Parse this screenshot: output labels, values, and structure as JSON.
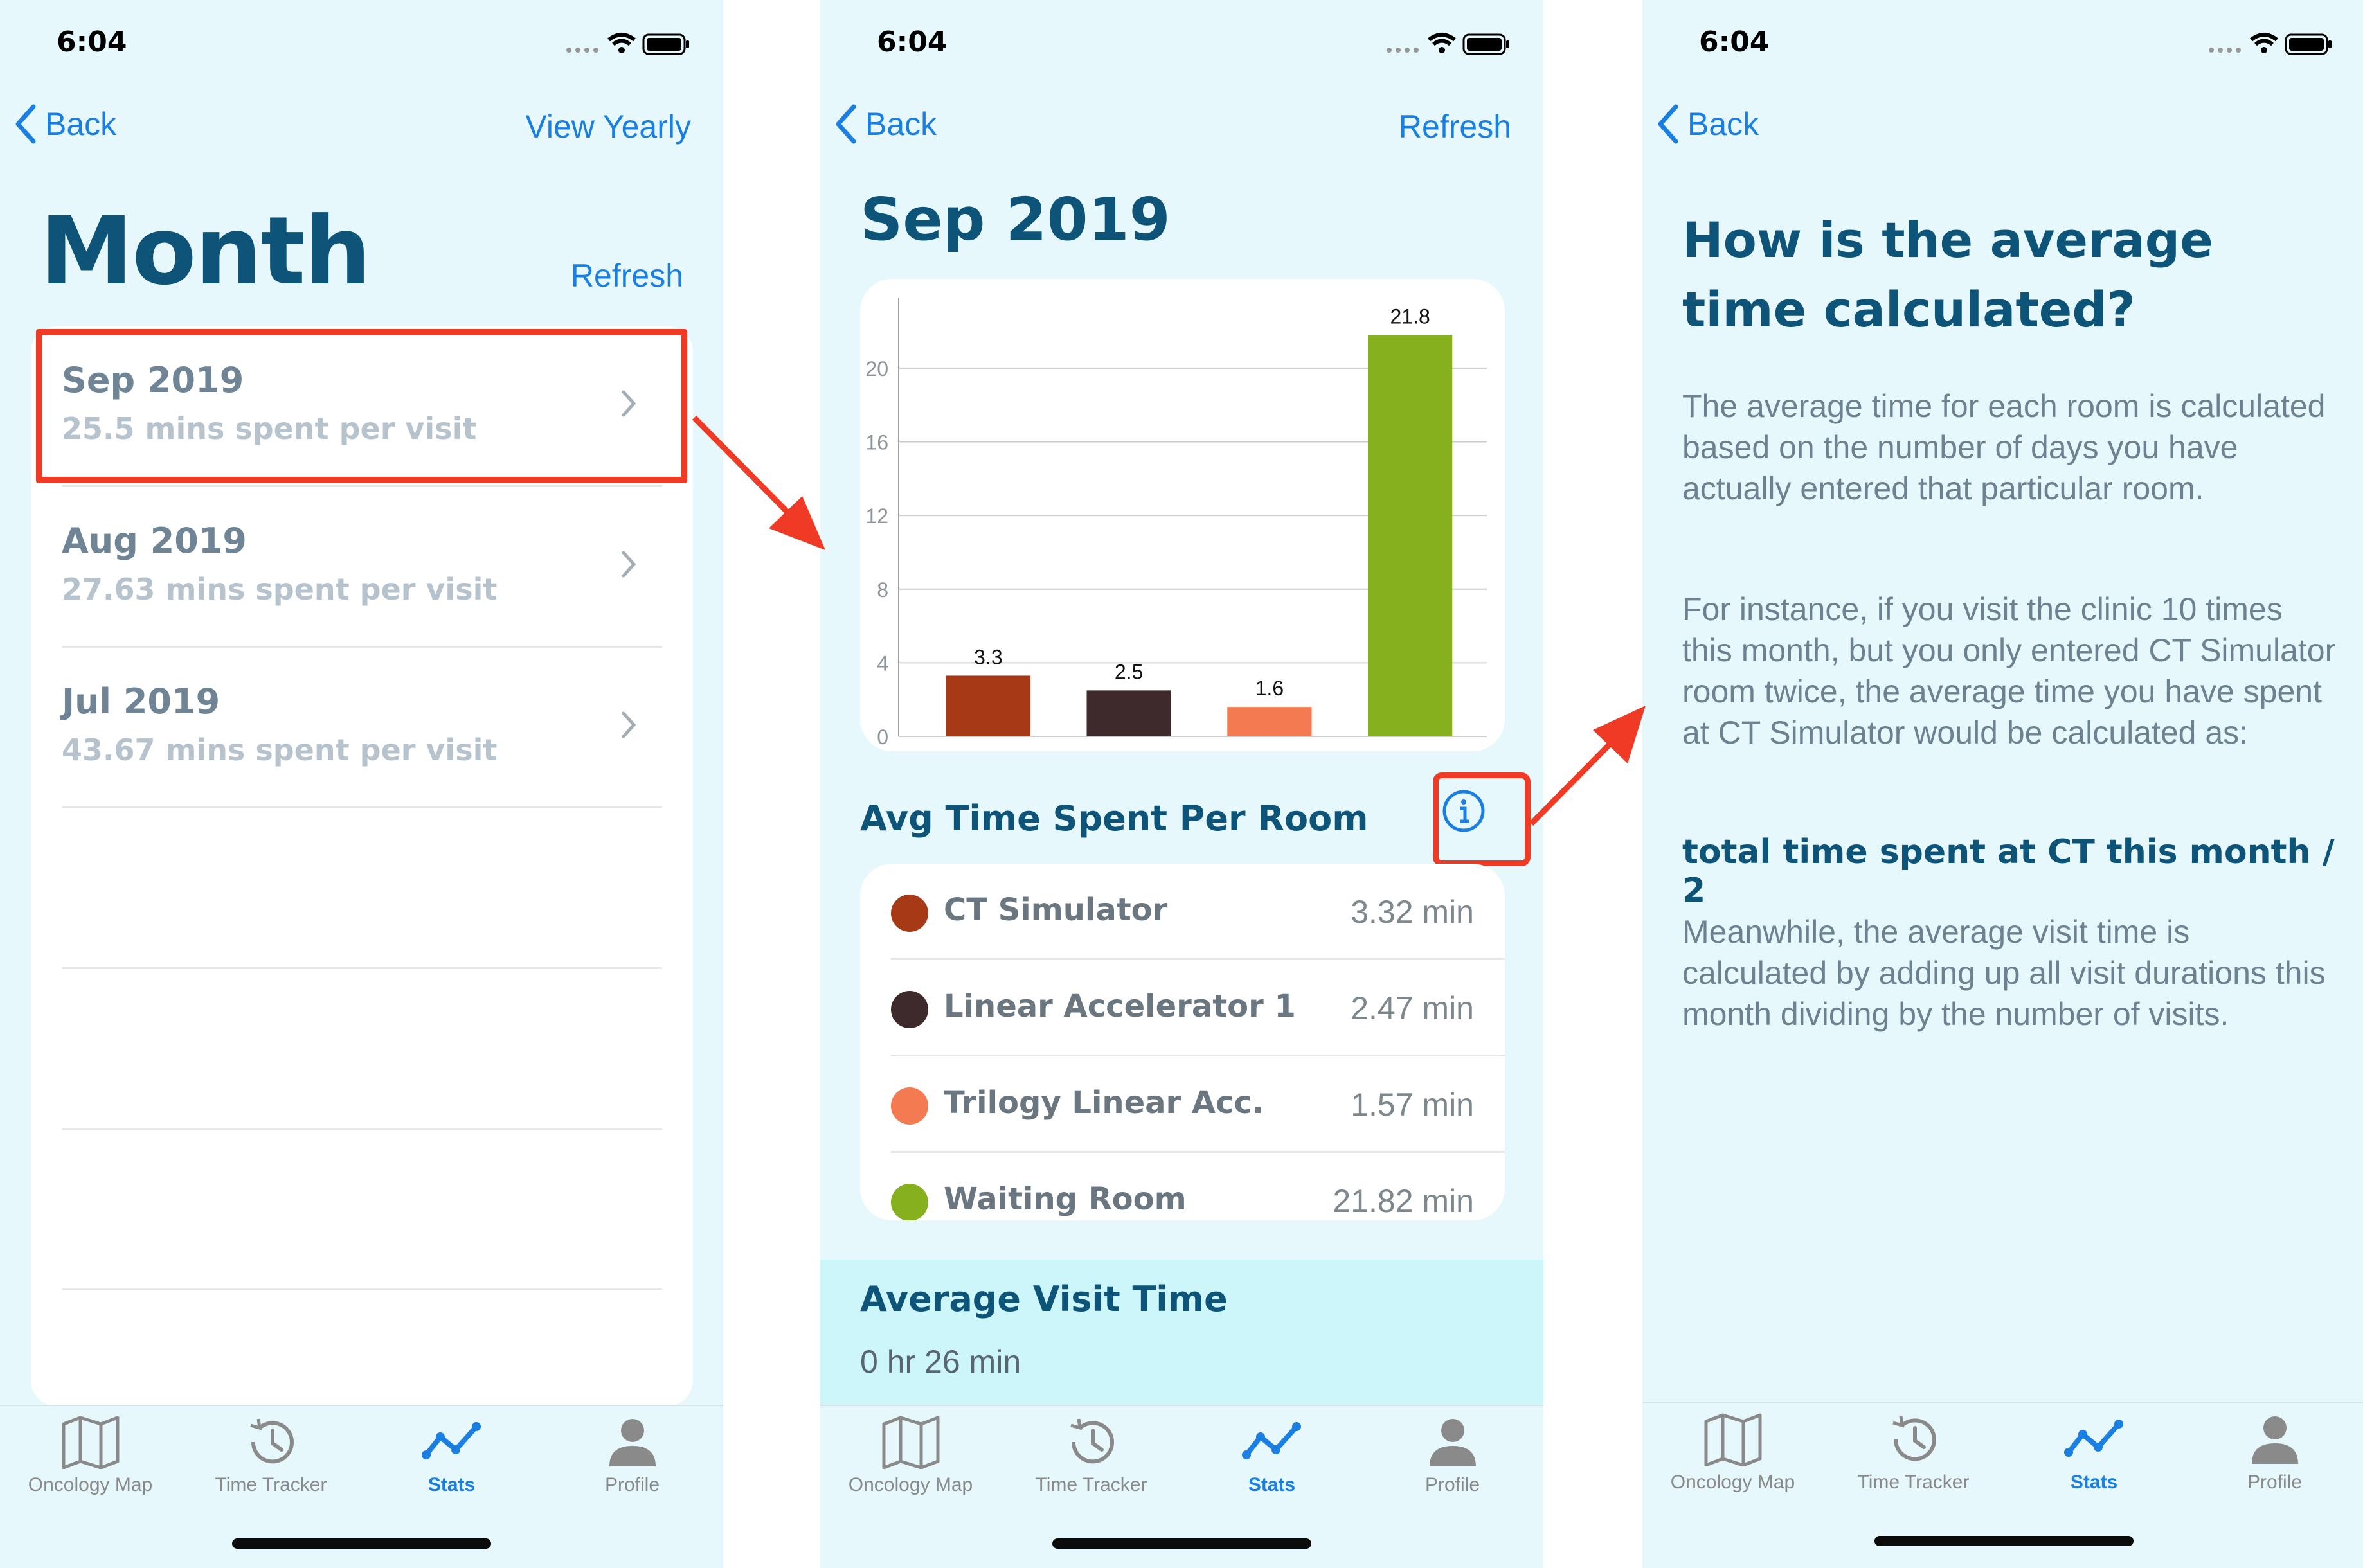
{
  "status": {
    "time": "6:04"
  },
  "colors": {
    "accent": "#1a7fe0",
    "title": "#0d5478",
    "highlight": "#ef3a25",
    "background": "#e6f8fc"
  },
  "tabs": [
    {
      "label": "Oncology Map",
      "icon": "map-icon"
    },
    {
      "label": "Time Tracker",
      "icon": "history-icon"
    },
    {
      "label": "Stats",
      "icon": "stats-icon",
      "active": true
    },
    {
      "label": "Profile",
      "icon": "person-icon"
    }
  ],
  "screen1": {
    "back_label": "Back",
    "right_label": "View Yearly",
    "title": "Month",
    "refresh_label": "Refresh",
    "months": [
      {
        "title": "Sep 2019",
        "subtitle": "25.5 mins spent per visit"
      },
      {
        "title": "Aug 2019",
        "subtitle": "27.63 mins spent per visit"
      },
      {
        "title": "Jul 2019",
        "subtitle": "43.67 mins spent per visit"
      }
    ]
  },
  "screen2": {
    "back_label": "Back",
    "right_label": "Refresh",
    "title": "Sep 2019",
    "section_title": "Avg Time Spent Per Room",
    "rooms": [
      {
        "name": "CT Simulator",
        "value": "3.32 min",
        "color": "#a63a16"
      },
      {
        "name": "Linear Accelerator 1",
        "value": "2.47 min",
        "color": "#3e2a2a"
      },
      {
        "name": "Trilogy Linear Acc.",
        "value": "1.57 min",
        "color": "#f47a52"
      },
      {
        "name": "Waiting Room",
        "value": "21.82 min",
        "color": "#86b01d"
      }
    ],
    "average_title": "Average Visit Time",
    "average_value": "0 hr 26 min"
  },
  "chart_data": {
    "type": "bar",
    "categories": [
      "CT Simulator",
      "Linear Accelerator 1",
      "Trilogy Linear Acc.",
      "Waiting Room"
    ],
    "values": [
      3.3,
      2.5,
      1.6,
      21.8
    ],
    "data_labels": [
      "3.3",
      "2.5",
      "1.6",
      "21.8"
    ],
    "colors": [
      "#a63a16",
      "#3e2a2a",
      "#f47a52",
      "#86b01d"
    ],
    "yticks": [
      0,
      4,
      8,
      12,
      16,
      20
    ],
    "ylim": [
      0,
      23.8
    ],
    "grid": true,
    "legend": "none"
  },
  "screen3": {
    "back_label": "Back",
    "title": "How is the average time calculated?",
    "para1": "The average time for each room is calculated based on the number of days you have actually entered that particular room.",
    "para2": "For instance, if you visit the clinic 10 times this month, but you only entered CT Simulator room twice, the average time you have spent at CT Simulator would be calculated as:",
    "formula": "total time spent at CT this month / 2",
    "para3": "Meanwhile, the average visit time is calculated by adding up all visit durations this month dividing by the number of visits."
  }
}
